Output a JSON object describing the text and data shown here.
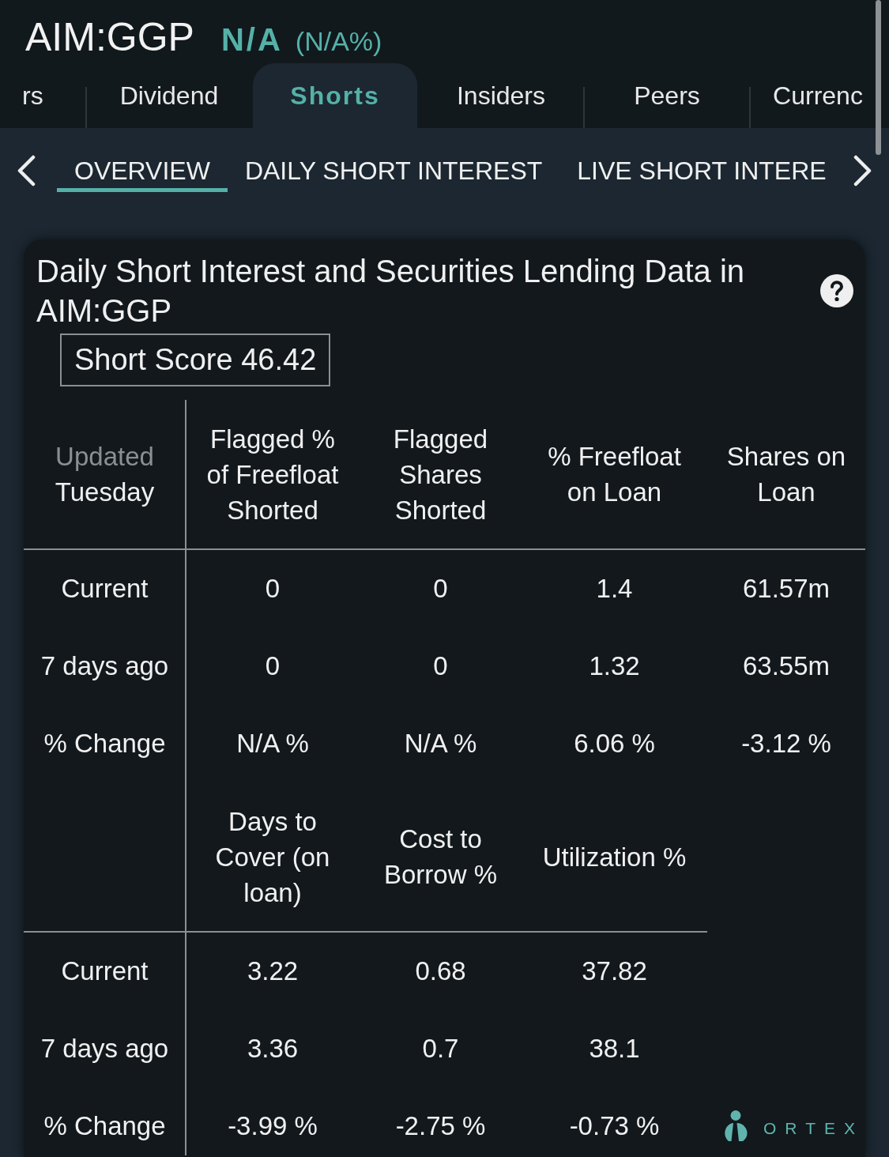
{
  "header": {
    "symbol": "AIM:GGP",
    "price": "N/A",
    "change": "(N/A%)"
  },
  "tabs": [
    {
      "label": "rs",
      "selected": false
    },
    {
      "label": "Dividend",
      "selected": false
    },
    {
      "label": "Shorts",
      "selected": true
    },
    {
      "label": "Insiders",
      "selected": false
    },
    {
      "label": "Peers",
      "selected": false
    },
    {
      "label": "Currenc",
      "selected": false
    }
  ],
  "subtabs": [
    {
      "label": "OVERVIEW",
      "selected": true
    },
    {
      "label": "DAILY SHORT INTEREST",
      "selected": false
    },
    {
      "label": "LIVE SHORT INTERE",
      "selected": false
    }
  ],
  "card": {
    "title": "Daily Short Interest and Securities Lending Data in AIM:GGP",
    "short_score": "Short Score 46.42",
    "sections": [
      {
        "corner": {
          "label": "Updated",
          "value": "Tuesday"
        },
        "columns": [
          "Flagged % of Freefloat Shorted",
          "Flagged Shares Shorted",
          "% Freefloat on Loan",
          "Shares on Loan"
        ],
        "rows": [
          {
            "label": "Current",
            "cells": [
              "0",
              "0",
              "1.4",
              "61.57m"
            ]
          },
          {
            "label": "7 days ago",
            "cells": [
              "0",
              "0",
              "1.32",
              "63.55m"
            ]
          },
          {
            "label": "% Change",
            "cells": [
              "N/A %",
              "N/A %",
              "6.06 %",
              "-3.12 %"
            ]
          }
        ]
      },
      {
        "columns": [
          "Days to Cover (on loan)",
          "Cost to Borrow %",
          "Utilization %"
        ],
        "rows": [
          {
            "label": "Current",
            "cells": [
              "3.22",
              "0.68",
              "37.82"
            ]
          },
          {
            "label": "7 days ago",
            "cells": [
              "3.36",
              "0.7",
              "38.1"
            ]
          },
          {
            "label": "% Change",
            "cells": [
              "-3.99 %",
              "-2.75 %",
              "-0.73 %"
            ]
          }
        ]
      }
    ],
    "logo": {
      "text": "ORTEX"
    }
  }
}
